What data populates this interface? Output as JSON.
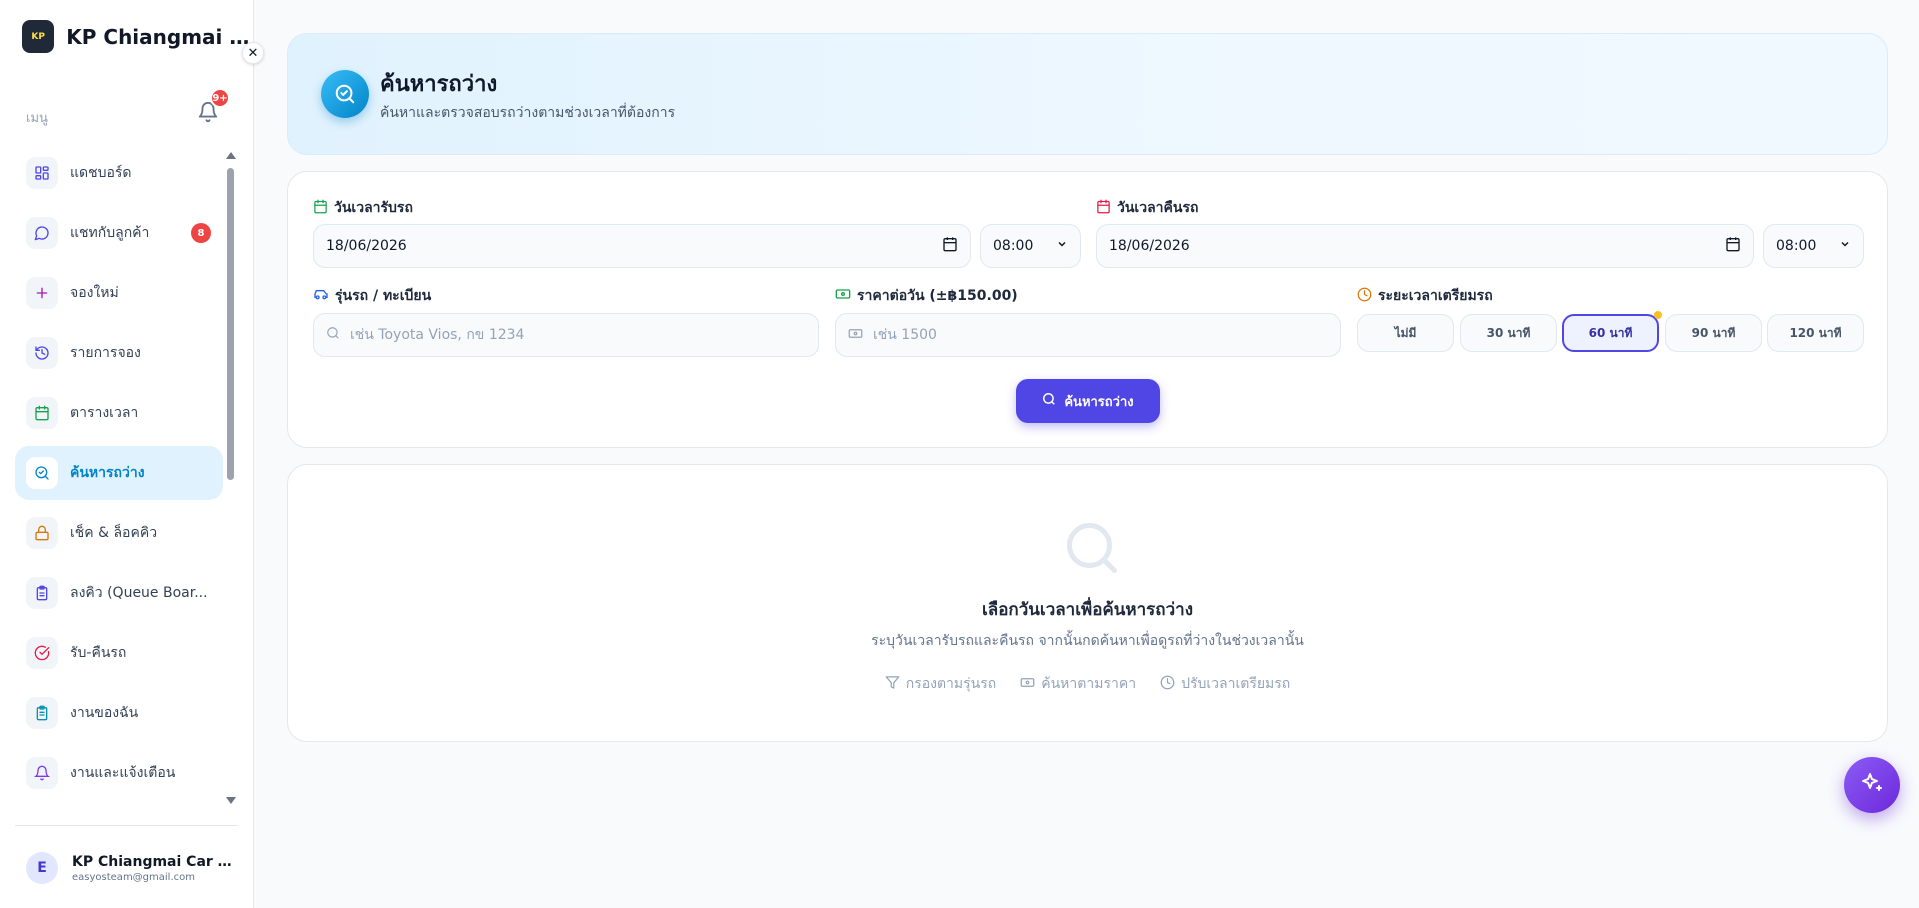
{
  "app": {
    "brand_name": "KP Chiangmai Car ...",
    "logo_text": "KP",
    "close_icon": "close-icon"
  },
  "sidebar": {
    "menu_label": "เมนู",
    "notification_badge": "9+",
    "items": [
      {
        "label": "แดชบอร์ด",
        "icon": "grid-icon",
        "color": "#4f46e5",
        "badge": ""
      },
      {
        "label": "แชทกับลูกค้า",
        "icon": "chat-icon",
        "color": "#4f46e5",
        "badge": "8"
      },
      {
        "label": "จองใหม่",
        "icon": "plus-icon",
        "color": "#a21caf",
        "badge": ""
      },
      {
        "label": "รายการจอง",
        "icon": "history-icon",
        "color": "#4f46e5",
        "badge": ""
      },
      {
        "label": "ตารางเวลา",
        "icon": "calendar-icon",
        "color": "#16a34a",
        "badge": ""
      },
      {
        "label": "ค้นหารถว่าง",
        "icon": "search-check-icon",
        "color": "#0284c7",
        "badge": "",
        "active": true
      },
      {
        "label": "เช็ค & ล็อคคิว",
        "icon": "lock-icon",
        "color": "#d97706",
        "badge": ""
      },
      {
        "label": "ลงคิว (Queue Boar...",
        "icon": "clipboard-icon",
        "color": "#4f46e5",
        "badge": ""
      },
      {
        "label": "รับ-คืนรถ",
        "icon": "check-circle-icon",
        "color": "#e11d48",
        "badge": ""
      },
      {
        "label": "งานของฉัน",
        "icon": "clipboard-list-icon",
        "color": "#0891b2",
        "badge": ""
      },
      {
        "label": "งานและแจ้งเตือน",
        "icon": "bell-icon",
        "color": "#7c3aed",
        "badge": ""
      }
    ],
    "user": {
      "initial": "E",
      "name": "KP Chiangmai Car Re...",
      "email": "easyosteam@gmail.com"
    }
  },
  "header": {
    "title": "ค้นหารถว่าง",
    "subtitle": "ค้นหาและตรวจสอบรถว่างตามช่วงเวลาที่ต้องการ"
  },
  "search": {
    "pickup_label": "วันเวลารับรถ",
    "pickup_date": "18/06/2026",
    "pickup_time": "08:00",
    "return_label": "วันเวลาคืนรถ",
    "return_date": "18/06/2026",
    "return_time": "08:00",
    "model_label": "รุ่นรถ / ทะเบียน",
    "model_placeholder": "เช่น Toyota Vios, กข 1234",
    "price_label": "ราคาต่อวัน (±฿150.00)",
    "price_placeholder": "เช่น 1500",
    "prep_label": "ระยะเวลาเตรียมรถ",
    "prep_options": [
      "ไม่มี",
      "30 นาที",
      "60 นาที",
      "90 นาที",
      "120 นาที"
    ],
    "prep_selected": "60 นาที",
    "search_button": "ค้นหารถว่าง"
  },
  "empty_state": {
    "title": "เลือกวันเวลาเพื่อค้นหารถว่าง",
    "subtitle": "ระบุวันเวลารับรถและคืนรถ จากนั้นกดค้นหาเพื่อดูรถที่ว่างในช่วงเวลานั้น",
    "hints": [
      {
        "label": "กรองตามรุ่นรถ",
        "icon": "filter-icon"
      },
      {
        "label": "ค้นหาตามราคา",
        "icon": "banknote-icon"
      },
      {
        "label": "ปรับเวลาเตรียมรถ",
        "icon": "clock-icon"
      }
    ]
  },
  "fab": {
    "icon": "sparkles-icon"
  },
  "colors": {
    "accent": "#4f46e5",
    "primary_blue": "#0284c7",
    "danger": "#ef4444",
    "warning": "#fbbf24"
  }
}
